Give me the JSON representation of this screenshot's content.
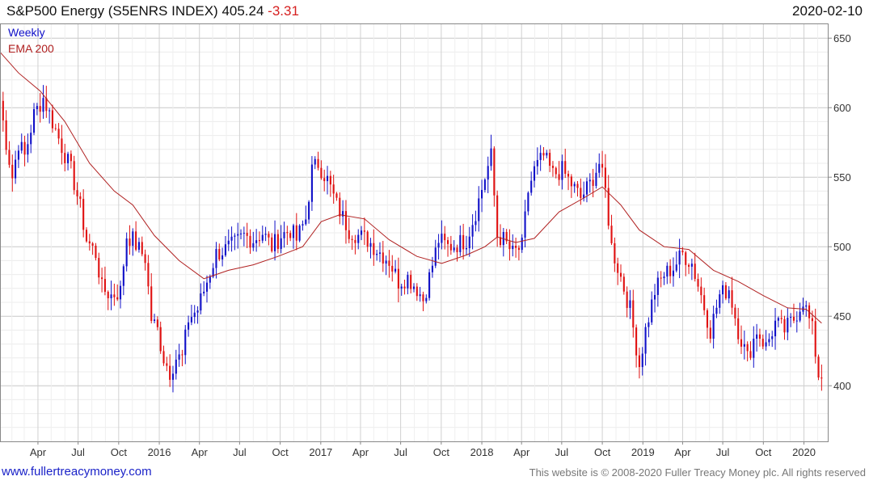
{
  "header": {
    "title": "S&P500 Energy (S5ENRS INDEX) 405.24",
    "change": "-3.31",
    "date": "2020-02-10"
  },
  "footer": {
    "link": "www.fullertreacymoney.com",
    "copyright": "This website is © 2008-2020 Fuller Treacy Money plc. All rights reserved"
  },
  "colors": {
    "up": "#1010c8",
    "down": "#e01010",
    "ema": "#b02020",
    "grid": "#d8d8d8",
    "frame": "#888888"
  },
  "chart_data": {
    "type": "candlestick",
    "legend": [
      {
        "label": "Weekly",
        "color": "#1010c8"
      },
      {
        "label": "EMA 200",
        "color": "#b02020"
      }
    ],
    "y_ticks": [
      400,
      450,
      500,
      550,
      600,
      650
    ],
    "ylim": [
      360,
      660
    ],
    "x_tick_labels": [
      "Apr",
      "Jul",
      "Oct",
      "2016",
      "Apr",
      "Jul",
      "Oct",
      "2017",
      "Apr",
      "Jul",
      "Oct",
      "2018",
      "Apr",
      "Jul",
      "Oct",
      "2019",
      "Apr",
      "Jul",
      "Oct",
      "2020"
    ],
    "x_tick_dates": [
      "2015-04-01",
      "2015-07-01",
      "2015-10-01",
      "2016-01-01",
      "2016-04-01",
      "2016-07-01",
      "2016-10-01",
      "2017-01-01",
      "2017-04-01",
      "2017-07-01",
      "2017-10-01",
      "2018-01-01",
      "2018-04-01",
      "2018-07-01",
      "2018-10-01",
      "2019-01-01",
      "2019-04-01",
      "2019-07-01",
      "2019-10-01",
      "2020-01-01"
    ],
    "x_range": [
      "2015-01-05",
      "2020-02-24"
    ],
    "last_date": "2020-02-10",
    "last_close": 405.24,
    "ema_200": [
      [
        "2015-01-05",
        640
      ],
      [
        "2015-02-16",
        625
      ],
      [
        "2015-04-06",
        612
      ],
      [
        "2015-06-01",
        590
      ],
      [
        "2015-07-27",
        560
      ],
      [
        "2015-09-21",
        540
      ],
      [
        "2015-11-02",
        530
      ],
      [
        "2015-12-21",
        508
      ],
      [
        "2016-02-15",
        490
      ],
      [
        "2016-04-11",
        477
      ],
      [
        "2016-06-06",
        483
      ],
      [
        "2016-08-01",
        487
      ],
      [
        "2016-09-26",
        493
      ],
      [
        "2016-11-21",
        500
      ],
      [
        "2017-01-02",
        518
      ],
      [
        "2017-02-13",
        523
      ],
      [
        "2017-04-10",
        520
      ],
      [
        "2017-06-05",
        505
      ],
      [
        "2017-08-07",
        493
      ],
      [
        "2017-10-02",
        488
      ],
      [
        "2017-11-27",
        494
      ],
      [
        "2018-01-08",
        500
      ],
      [
        "2018-02-05",
        507
      ],
      [
        "2018-03-19",
        503
      ],
      [
        "2018-04-30",
        506
      ],
      [
        "2018-06-25",
        525
      ],
      [
        "2018-08-20",
        535
      ],
      [
        "2018-10-01",
        543
      ],
      [
        "2018-11-12",
        530
      ],
      [
        "2018-12-24",
        512
      ],
      [
        "2019-02-18",
        500
      ],
      [
        "2019-04-15",
        498
      ],
      [
        "2019-06-10",
        483
      ],
      [
        "2019-08-05",
        475
      ],
      [
        "2019-09-30",
        465
      ],
      [
        "2019-11-25",
        456
      ],
      [
        "2020-01-06",
        455
      ],
      [
        "2020-02-10",
        445
      ]
    ],
    "anchors": [
      [
        "2015-01-05",
        605
      ],
      [
        "2015-01-19",
        575
      ],
      [
        "2015-02-02",
        550
      ],
      [
        "2015-02-16",
        575
      ],
      [
        "2015-03-02",
        565
      ],
      [
        "2015-03-23",
        595
      ],
      [
        "2015-04-13",
        607
      ],
      [
        "2015-05-04",
        590
      ],
      [
        "2015-05-25",
        572
      ],
      [
        "2015-06-15",
        555
      ],
      [
        "2015-07-06",
        528
      ],
      [
        "2015-07-20",
        505
      ],
      [
        "2015-08-10",
        495
      ],
      [
        "2015-08-24",
        470
      ],
      [
        "2015-09-14",
        465
      ],
      [
        "2015-10-05",
        468
      ],
      [
        "2015-10-19",
        508
      ],
      [
        "2015-11-02",
        505
      ],
      [
        "2015-11-16",
        498
      ],
      [
        "2015-11-30",
        492
      ],
      [
        "2015-12-14",
        448
      ],
      [
        "2015-12-28",
        440
      ],
      [
        "2016-01-11",
        420
      ],
      [
        "2016-01-25",
        410
      ],
      [
        "2016-02-08",
        420
      ],
      [
        "2016-02-22",
        420
      ],
      [
        "2016-03-07",
        448
      ],
      [
        "2016-03-28",
        455
      ],
      [
        "2016-04-18",
        475
      ],
      [
        "2016-05-09",
        495
      ],
      [
        "2016-05-30",
        498
      ],
      [
        "2016-06-20",
        502
      ],
      [
        "2016-07-11",
        508
      ],
      [
        "2016-08-01",
        505
      ],
      [
        "2016-08-22",
        510
      ],
      [
        "2016-09-12",
        500
      ],
      [
        "2016-10-03",
        508
      ],
      [
        "2016-10-24",
        512
      ],
      [
        "2016-11-07",
        505
      ],
      [
        "2016-11-28",
        520
      ],
      [
        "2016-12-12",
        555
      ],
      [
        "2016-12-26",
        560
      ],
      [
        "2017-01-16",
        548
      ],
      [
        "2017-02-06",
        530
      ],
      [
        "2017-03-06",
        512
      ],
      [
        "2017-03-27",
        508
      ],
      [
        "2017-04-17",
        505
      ],
      [
        "2017-05-08",
        498
      ],
      [
        "2017-06-05",
        490
      ],
      [
        "2017-06-26",
        475
      ],
      [
        "2017-07-17",
        478
      ],
      [
        "2017-08-07",
        470
      ],
      [
        "2017-08-21",
        462
      ],
      [
        "2017-09-04",
        478
      ],
      [
        "2017-09-25",
        505
      ],
      [
        "2017-10-16",
        500
      ],
      [
        "2017-11-06",
        502
      ],
      [
        "2017-11-27",
        505
      ],
      [
        "2017-12-18",
        525
      ],
      [
        "2018-01-08",
        550
      ],
      [
        "2018-01-22",
        565
      ],
      [
        "2018-02-05",
        508
      ],
      [
        "2018-02-19",
        505
      ],
      [
        "2018-03-12",
        495
      ],
      [
        "2018-04-02",
        500
      ],
      [
        "2018-04-16",
        540
      ],
      [
        "2018-04-30",
        555
      ],
      [
        "2018-05-21",
        565
      ],
      [
        "2018-06-11",
        552
      ],
      [
        "2018-07-02",
        555
      ],
      [
        "2018-07-23",
        545
      ],
      [
        "2018-08-13",
        535
      ],
      [
        "2018-09-03",
        545
      ],
      [
        "2018-09-24",
        560
      ],
      [
        "2018-10-08",
        540
      ],
      [
        "2018-10-22",
        500
      ],
      [
        "2018-11-12",
        478
      ],
      [
        "2018-12-03",
        455
      ],
      [
        "2018-12-24",
        415
      ],
      [
        "2019-01-07",
        440
      ],
      [
        "2019-01-28",
        468
      ],
      [
        "2019-02-18",
        480
      ],
      [
        "2019-03-11",
        485
      ],
      [
        "2019-04-01",
        495
      ],
      [
        "2019-04-22",
        488
      ],
      [
        "2019-05-13",
        465
      ],
      [
        "2019-06-03",
        440
      ],
      [
        "2019-06-24",
        465
      ],
      [
        "2019-07-15",
        470
      ],
      [
        "2019-08-05",
        440
      ],
      [
        "2019-08-26",
        420
      ],
      [
        "2019-09-16",
        440
      ],
      [
        "2019-10-07",
        428
      ],
      [
        "2019-10-28",
        445
      ],
      [
        "2019-11-18",
        440
      ],
      [
        "2019-12-09",
        448
      ],
      [
        "2019-12-30",
        462
      ],
      [
        "2020-01-20",
        440
      ],
      [
        "2020-02-03",
        408
      ],
      [
        "2020-02-10",
        405
      ]
    ]
  }
}
